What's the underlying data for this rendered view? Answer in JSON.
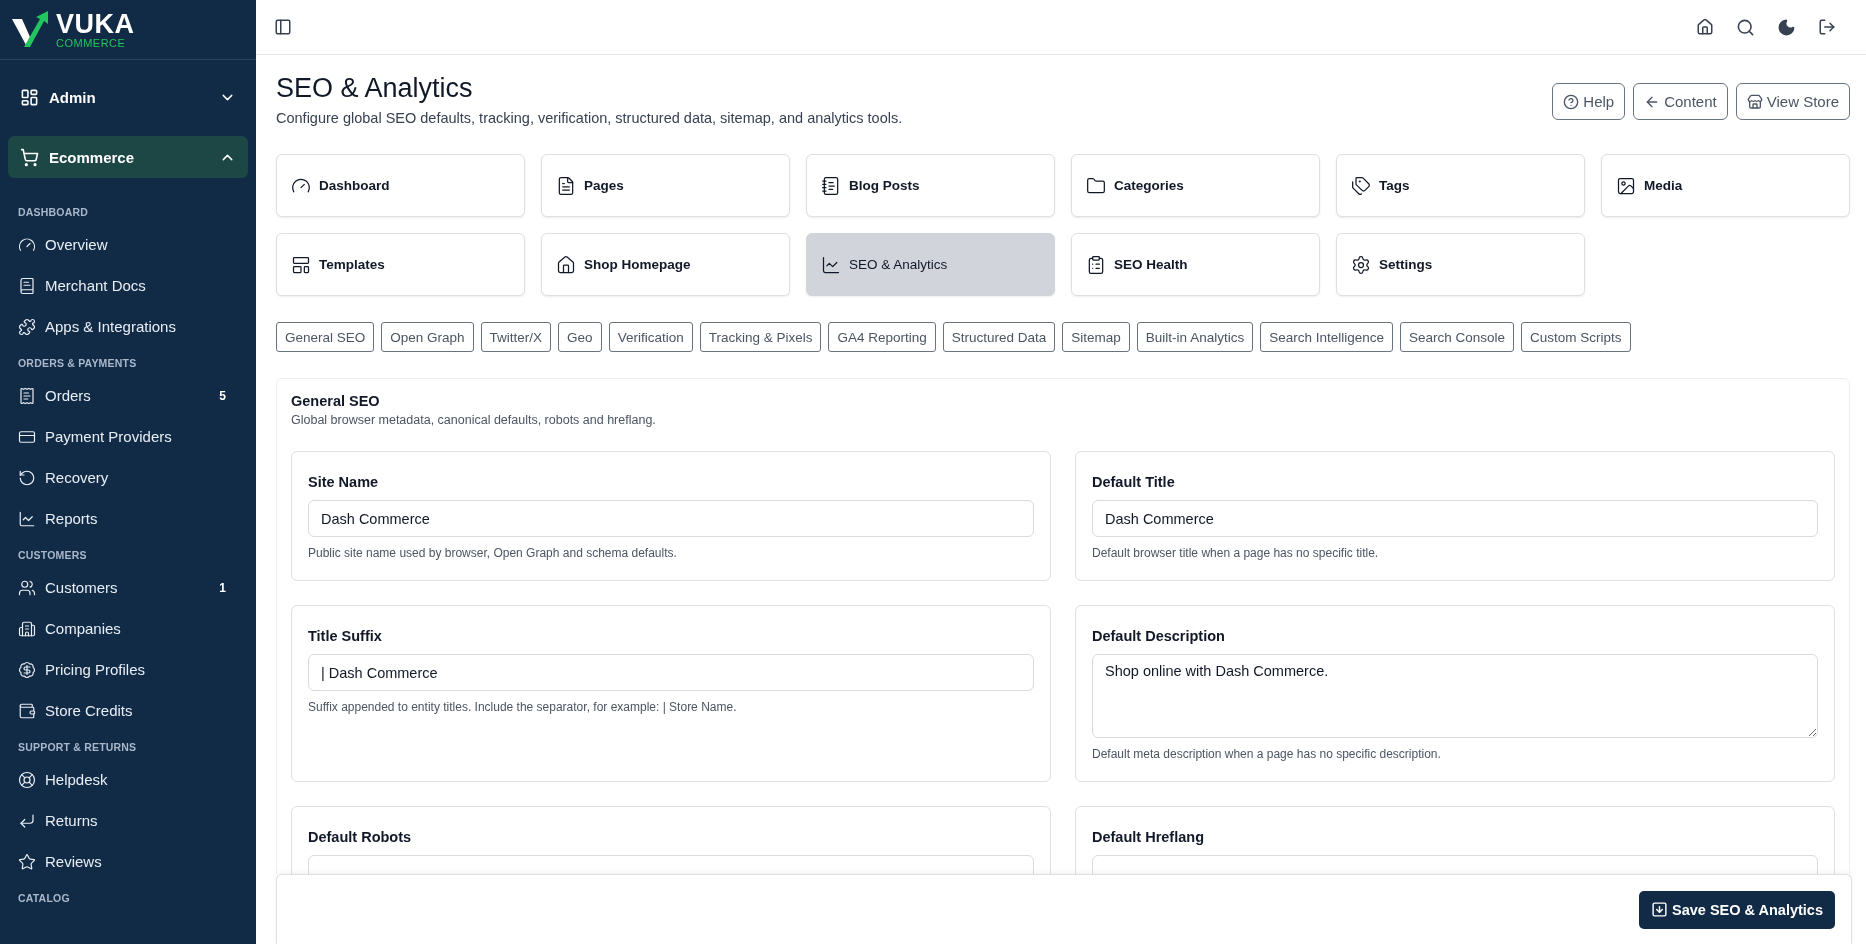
{
  "brand": {
    "name": "VUKA",
    "tagline": "COMMERCE"
  },
  "sidebar": {
    "groups": [
      {
        "label": "Admin",
        "kind": "admin",
        "expanded": false,
        "selected": false
      },
      {
        "label": "Ecommerce",
        "kind": "cart",
        "expanded": true,
        "selected": true
      }
    ],
    "sections": [
      {
        "title": "DASHBOARD",
        "items": [
          {
            "label": "Overview",
            "kind": "gauge"
          },
          {
            "label": "Merchant Docs",
            "kind": "docs"
          },
          {
            "label": "Apps & Integrations",
            "kind": "puzzle"
          }
        ]
      },
      {
        "title": "ORDERS & PAYMENTS",
        "items": [
          {
            "label": "Orders",
            "kind": "orders",
            "badge": "5"
          },
          {
            "label": "Payment Providers",
            "kind": "card"
          },
          {
            "label": "Recovery",
            "kind": "recovery"
          },
          {
            "label": "Reports",
            "kind": "chart"
          }
        ]
      },
      {
        "title": "CUSTOMERS",
        "items": [
          {
            "label": "Customers",
            "kind": "users",
            "badge": "1"
          },
          {
            "label": "Companies",
            "kind": "building"
          },
          {
            "label": "Pricing Profiles",
            "kind": "pricing"
          },
          {
            "label": "Store Credits",
            "kind": "wallet"
          }
        ]
      },
      {
        "title": "SUPPORT & RETURNS",
        "items": [
          {
            "label": "Helpdesk",
            "kind": "lifebuoy"
          },
          {
            "label": "Returns",
            "kind": "return"
          },
          {
            "label": "Reviews",
            "kind": "star"
          }
        ]
      },
      {
        "title": "CATALOG"
      }
    ]
  },
  "page": {
    "title": "SEO & Analytics",
    "subtitle": "Configure global SEO defaults, tracking, verification, structured data, sitemap, and analytics tools.",
    "actions": [
      {
        "label": "Help",
        "kind": "help"
      },
      {
        "label": "Content",
        "kind": "back"
      },
      {
        "label": "View Store",
        "kind": "store"
      }
    ]
  },
  "nav_cards": [
    {
      "label": "Dashboard",
      "kind": "gauge",
      "selected": false
    },
    {
      "label": "Pages",
      "kind": "page",
      "selected": false
    },
    {
      "label": "Blog Posts",
      "kind": "blog",
      "selected": false
    },
    {
      "label": "Categories",
      "kind": "folder",
      "selected": false
    },
    {
      "label": "Tags",
      "kind": "tags",
      "selected": false
    },
    {
      "label": "Media",
      "kind": "image",
      "selected": false
    },
    {
      "label": "Templates",
      "kind": "template",
      "selected": false
    },
    {
      "label": "Shop Homepage",
      "kind": "home",
      "selected": false
    },
    {
      "label": "SEO & Analytics",
      "kind": "chart",
      "selected": true
    },
    {
      "label": "SEO Health",
      "kind": "health",
      "selected": false
    },
    {
      "label": "Settings",
      "kind": "settings",
      "selected": false
    }
  ],
  "tabs": [
    {
      "label": "General SEO",
      "selected": false
    },
    {
      "label": "Open Graph",
      "selected": false
    },
    {
      "label": "Twitter/X",
      "selected": false
    },
    {
      "label": "Geo",
      "selected": false
    },
    {
      "label": "Verification",
      "selected": false
    },
    {
      "label": "Tracking & Pixels",
      "selected": false
    },
    {
      "label": "GA4 Reporting",
      "selected": false
    },
    {
      "label": "Structured Data",
      "selected": false
    },
    {
      "label": "Sitemap",
      "selected": false
    },
    {
      "label": "Built-in Analytics",
      "selected": false
    },
    {
      "label": "Search Intelligence",
      "selected": false
    },
    {
      "label": "Search Console",
      "selected": false
    },
    {
      "label": "Custom Scripts",
      "selected": false
    }
  ],
  "section": {
    "title": "General SEO",
    "description": "Global browser metadata, canonical defaults, robots and hreflang.",
    "fields": [
      {
        "label": "Site Name",
        "kind": "input",
        "value": "Dash Commerce",
        "help": "Public site name used by browser, Open Graph and schema defaults."
      },
      {
        "label": "Default Title",
        "kind": "input",
        "value": "Dash Commerce",
        "help": "Default browser title when a page has no specific title."
      },
      {
        "label": "Title Suffix",
        "kind": "input",
        "value": "| Dash Commerce",
        "help": "Suffix appended to entity titles. Include the separator, for example: | Store Name."
      },
      {
        "label": "Default Description",
        "kind": "textarea",
        "value": "Shop online with Dash Commerce.",
        "help": "Default meta description when a page has no specific description."
      },
      {
        "label": "Default Robots",
        "kind": "input"
      },
      {
        "label": "Default Hreflang",
        "kind": "input"
      }
    ]
  },
  "save_button": {
    "label": "Save SEO & Analytics"
  }
}
